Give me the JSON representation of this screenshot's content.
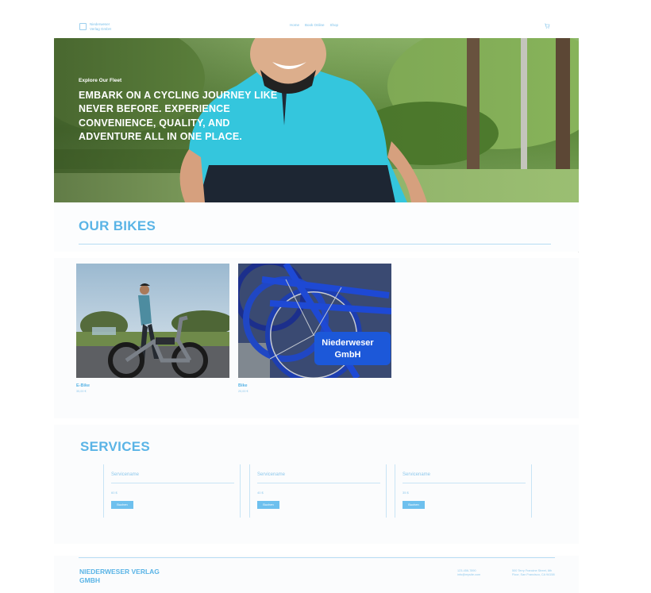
{
  "header": {
    "brand": "Niederweser Verlag GmbH",
    "nav": [
      "Home",
      "Book Online",
      "Shop"
    ]
  },
  "hero": {
    "eyebrow": "Explore Our Fleet",
    "title": "Embark on a cycling journey like never before. Experience convenience, quality, and adventure all in one place."
  },
  "bikes": {
    "title": "OUR BIKES",
    "items": [
      {
        "name": "E-Bike",
        "price": "35,00 €"
      },
      {
        "name": "Bike",
        "price": "20,00 €"
      }
    ],
    "decal_text": "Niederweser GmbH"
  },
  "services": {
    "title": "SERVICES",
    "items": [
      {
        "name": "Servicename",
        "price": "60 $",
        "button": "Buchen"
      },
      {
        "name": "Servicename",
        "price": "40 $",
        "button": "Buchen"
      },
      {
        "name": "Servicename",
        "price": "35 $",
        "button": "Buchen"
      }
    ]
  },
  "footer": {
    "brand": "NIEDERWESER VERLAG GMBH",
    "phone": "123-456-7890",
    "email": "info@mysite.com",
    "address": "500 Terry Francine Street, 6th Floor, San Francisco, CA 94158"
  },
  "colors": {
    "accent": "#5ab4e6",
    "button": "#6ec0ee",
    "line": "#b6dcf3"
  }
}
